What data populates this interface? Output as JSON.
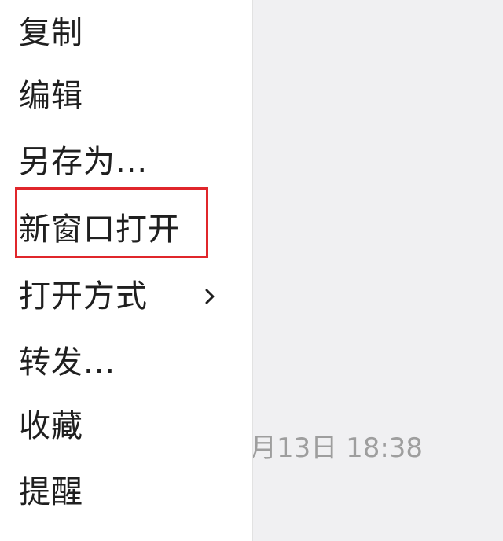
{
  "chat": {
    "timestamp": "月13日 18:38"
  },
  "context_menu": {
    "items": [
      {
        "label": "复制"
      },
      {
        "label": "编辑"
      },
      {
        "label": "另存为..."
      },
      {
        "label": "新窗口打开",
        "highlighted": true
      },
      {
        "label": "打开方式",
        "has_submenu": true,
        "submenu_icon": "chevron-right-icon"
      },
      {
        "label": "转发..."
      },
      {
        "label": "收藏"
      },
      {
        "label": "提醒"
      }
    ],
    "highlight_color": "#e0262b"
  }
}
